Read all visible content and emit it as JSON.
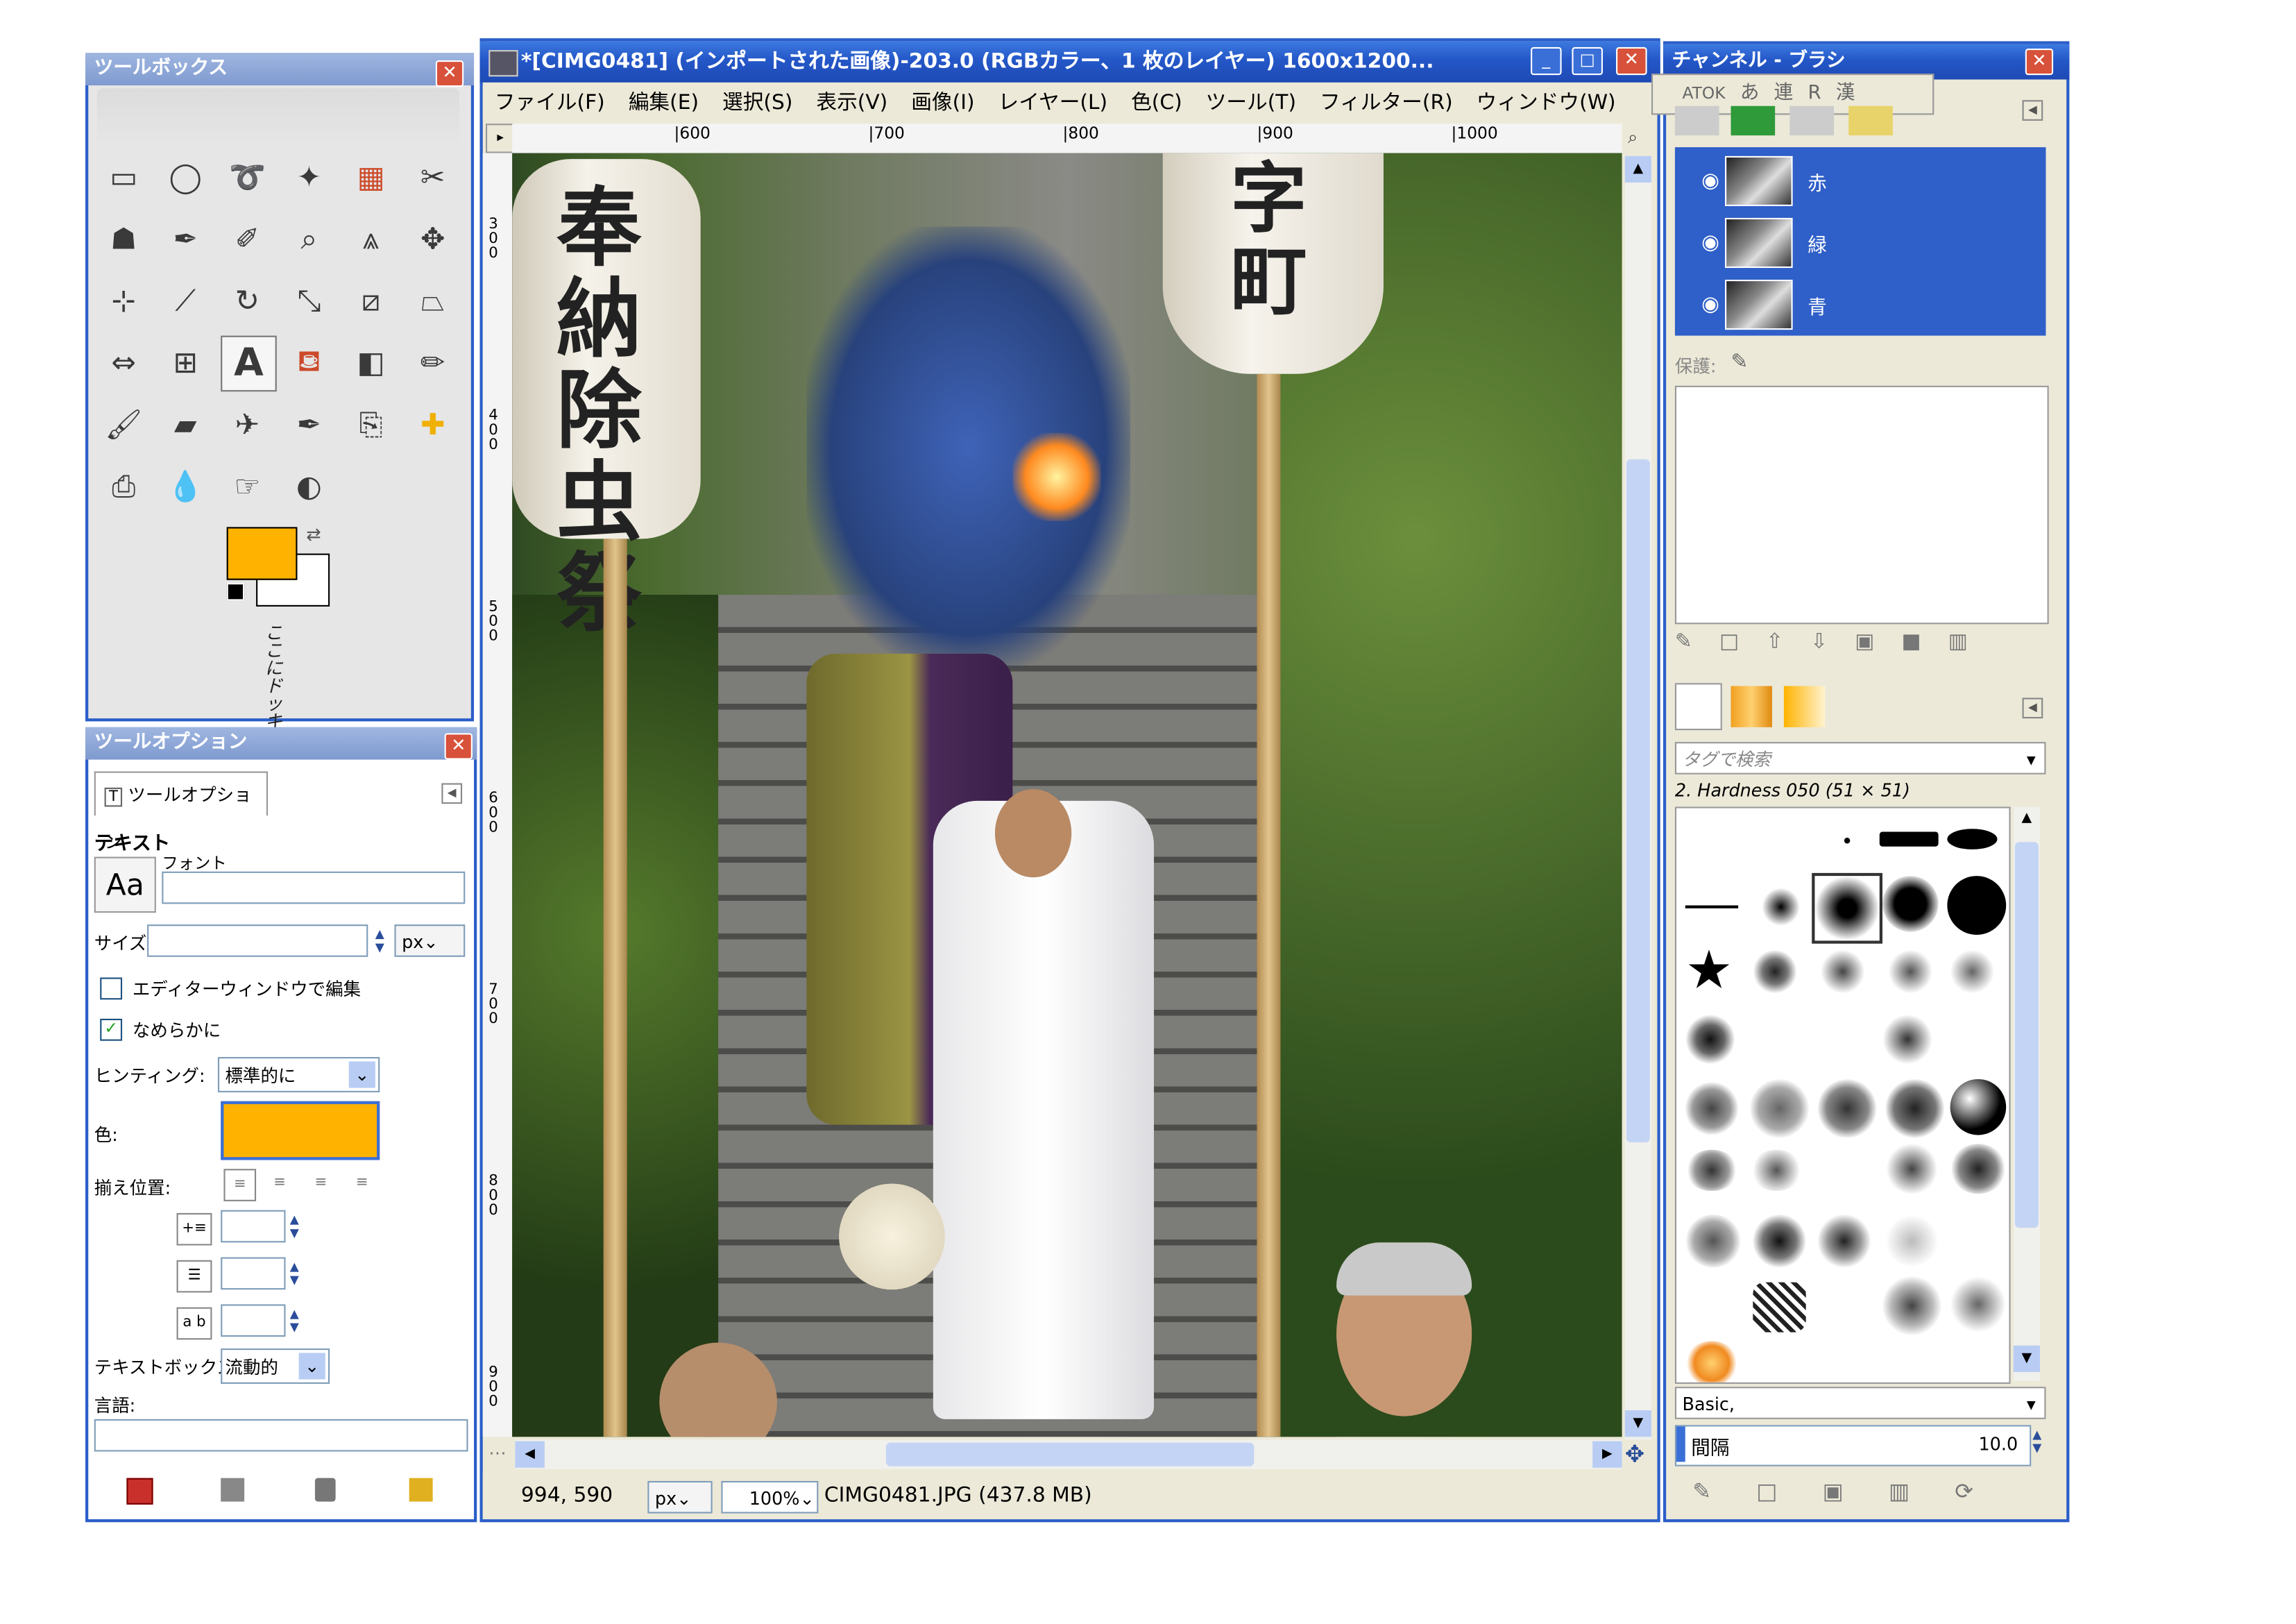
{
  "toolbox": {
    "title": "ツールボックス",
    "tools": [
      "rect-select",
      "ellipse-select",
      "free-select",
      "fuzzy-select",
      "color-select",
      "scissors",
      "foreground-select",
      "paths",
      "color-picker",
      "zoom",
      "measure",
      "move",
      "align",
      "crop",
      "rotate",
      "scale",
      "shear",
      "perspective",
      "flip",
      "cage",
      "text",
      "bucket-fill",
      "blend",
      "pencil",
      "paintbrush",
      "eraser",
      "airbrush",
      "ink",
      "clone",
      "heal",
      "perspective-clone",
      "blur",
      "smudge",
      "dodge"
    ],
    "fg_color": "#ffb300",
    "bg_color": "#ffffff",
    "drop_text": "ここにドッキング可"
  },
  "tool_options": {
    "title": "ツールオプション",
    "tab_label": "ツールオプション",
    "section": "テキスト",
    "font_label": "フォント",
    "font_preview": "Aa",
    "size_label": "サイズ:",
    "size_unit": "px",
    "editor_label": "エディターウィンドウで編集",
    "antialias_label": "なめらかに",
    "hinting_label": "ヒンティング:",
    "hinting_value": "標準的に",
    "color_label": "色:",
    "color": "#ffb300",
    "justify_label": "揃え位置:",
    "textbox_label": "テキストボックス:",
    "textbox_value": "流動的",
    "language_label": "言語:",
    "ab_label": "a b"
  },
  "image_window": {
    "title": "*[CIMG0481] (インポートされた画像)-203.0 (RGBカラー、1 枚のレイヤー) 1600x1200...",
    "menu": [
      "ファイル(F)",
      "編集(E)",
      "選択(S)",
      "表示(V)",
      "画像(I)",
      "レイヤー(L)",
      "色(C)",
      "ツール(T)",
      "フィルター(R)",
      "ウィンドウ(W)"
    ],
    "ruler_h": [
      "|600",
      "|700",
      "|800",
      "|900",
      "|1000"
    ],
    "ruler_v": [
      "300",
      "400",
      "500",
      "600",
      "700",
      "800",
      "900"
    ],
    "lantern_left": "奉納除虫祭",
    "lantern_right": "字町",
    "coords": "994, 590",
    "unit": "px",
    "zoom": "100%",
    "file_info": "CIMG0481.JPG (437.8 MB)"
  },
  "channels": {
    "title": "チャンネル - ブラシ",
    "ime": [
      "ATOK",
      "あ",
      "連",
      "R",
      "漢"
    ],
    "items": [
      "赤",
      "緑",
      "青"
    ],
    "lock_label": "保護:",
    "tag_placeholder": "タグで検索",
    "brush_name": "2. Hardness 050 (51 × 51)",
    "preset": "Basic,",
    "spacing_label": "間隔",
    "spacing_value": "10.0"
  }
}
